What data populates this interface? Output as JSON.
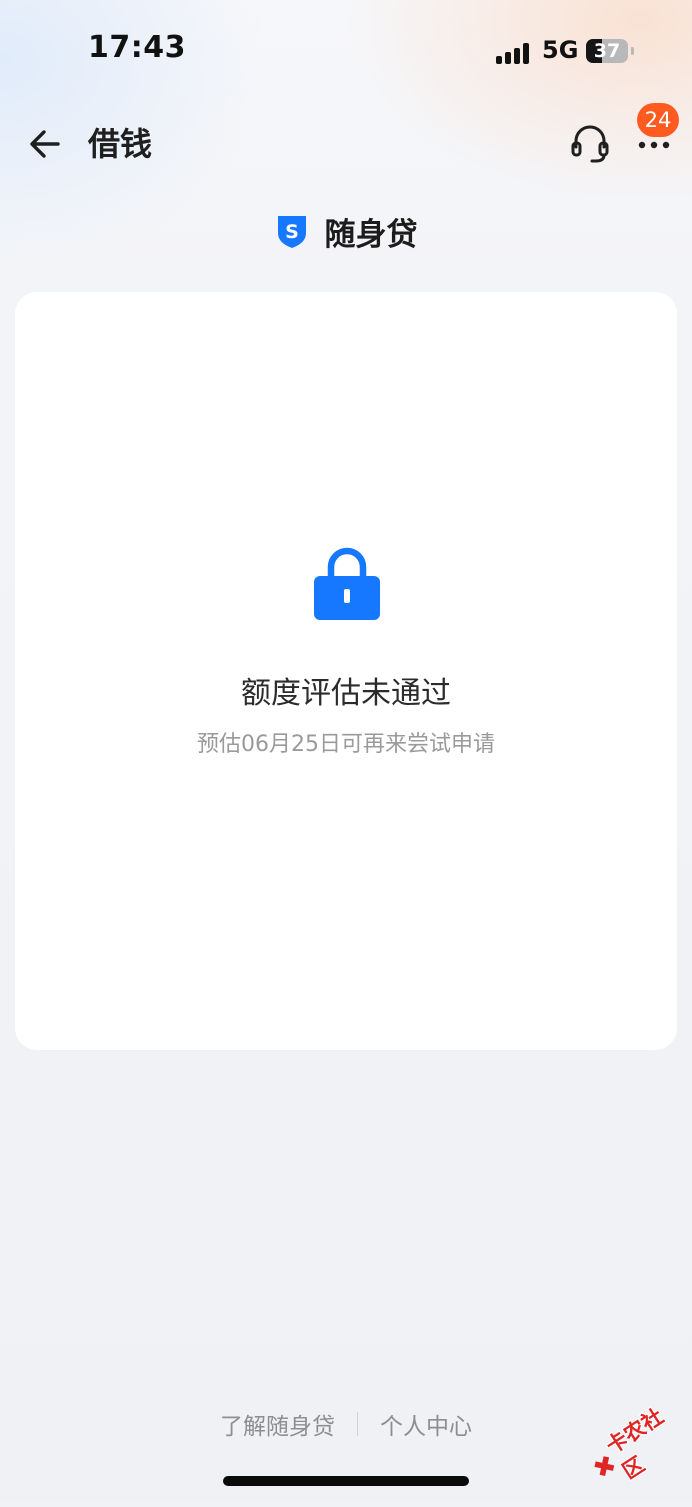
{
  "status_bar": {
    "time": "17:43",
    "network": "5G",
    "battery_level": "37",
    "signal_icon": "cellular-signal-icon",
    "battery_icon": "battery-icon"
  },
  "nav": {
    "back_icon": "arrow-left-icon",
    "title": "借钱",
    "service_icon": "headset-icon",
    "more_icon": "more-dots-icon",
    "badge_count": "24",
    "badge_color": "#ff5a1f"
  },
  "product": {
    "logo_icon": "shield-s-icon",
    "logo_letter": "S",
    "name": "随身贷",
    "accent_color": "#1677ff"
  },
  "result": {
    "icon": "lock-icon",
    "title": "额度评估未通过",
    "subtitle": "预估06月25日可再来尝试申请"
  },
  "footer": {
    "links": [
      "了解随身贷",
      "个人中心"
    ]
  },
  "watermark": {
    "text": "卡农社区"
  }
}
